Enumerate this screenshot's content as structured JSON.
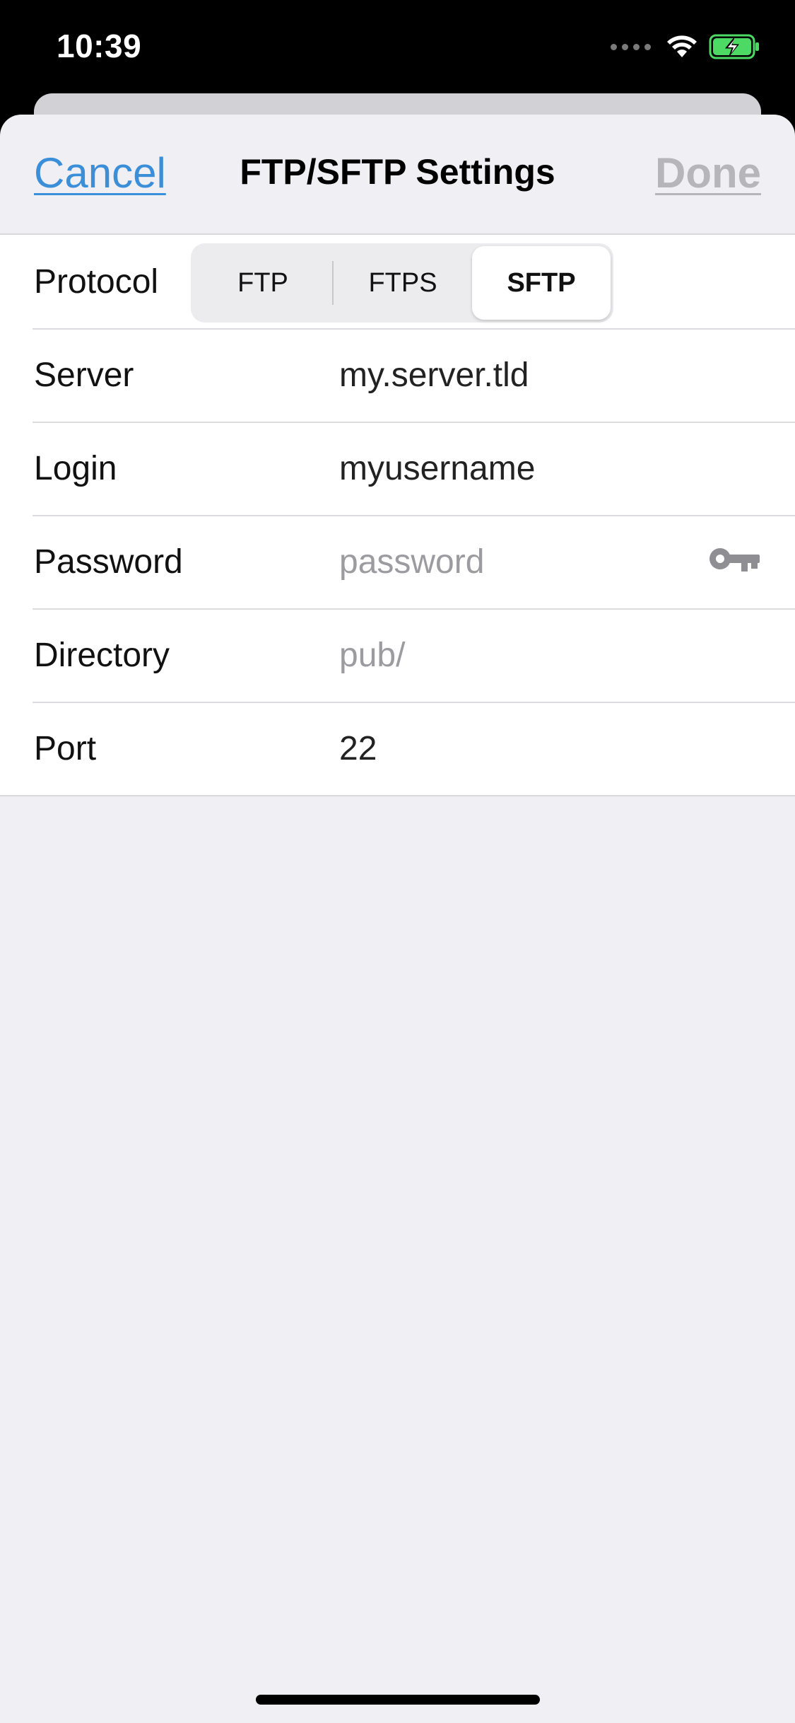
{
  "status_bar": {
    "time": "10:39"
  },
  "nav": {
    "cancel_label": "Cancel",
    "title": "FTP/SFTP Settings",
    "done_label": "Done"
  },
  "form": {
    "protocol": {
      "label": "Protocol",
      "options": [
        "FTP",
        "FTPS",
        "SFTP"
      ],
      "selected": "SFTP"
    },
    "server": {
      "label": "Server",
      "value": "my.server.tld"
    },
    "login": {
      "label": "Login",
      "value": "myusername"
    },
    "password": {
      "label": "Password",
      "placeholder": "password",
      "icon": "key-icon"
    },
    "directory": {
      "label": "Directory",
      "placeholder": "pub/"
    },
    "port": {
      "label": "Port",
      "value": "22"
    }
  },
  "colors": {
    "accent": "#3b8ed8",
    "disabled": "#b5b5ba",
    "background": "#efeff4",
    "battery_green": "#4cd964"
  }
}
